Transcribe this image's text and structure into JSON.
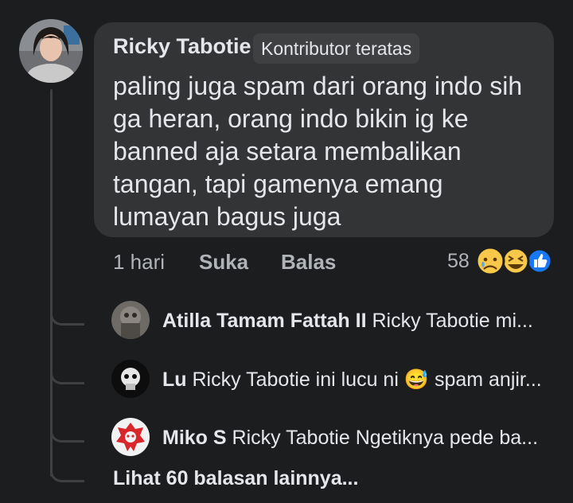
{
  "comment": {
    "author": "Ricky Tabotie",
    "badge": "Kontributor teratas",
    "text_lines": [
      "paling juga spam dari orang indo sih",
      "ga heran, orang indo bikin ig ke",
      "banned aja setara membalikan",
      "tangan, tapi gamenya emang",
      "lumayan bagus juga"
    ],
    "time": "1 hari",
    "like_label": "Suka",
    "reply_label": "Balas",
    "reaction_count": "58",
    "reactions": [
      "sad-reaction-icon",
      "haha-reaction-icon",
      "like-reaction-icon"
    ]
  },
  "replies": [
    {
      "name": "Atilla Tamam Fattah II",
      "text": "Ricky Tabotie mi..."
    },
    {
      "name": "Lu",
      "text": "Ricky Tabotie ini lucu ni",
      "emoji": "😅",
      "text_after": "spam anjir..."
    },
    {
      "name": "Miko S",
      "text": "Ricky Tabotie Ngetiknya pede ba..."
    }
  ],
  "more_replies": "Lihat 60 balasan lainnya...",
  "colors": {
    "background": "#1c1d1f",
    "bubble": "#333436",
    "badge_bg": "#3e4042",
    "primary_text": "#e4e6eb",
    "secondary_text": "#b0b3b8",
    "like_blue": "#1877f2",
    "reaction_yellow": "#f7c84a"
  }
}
